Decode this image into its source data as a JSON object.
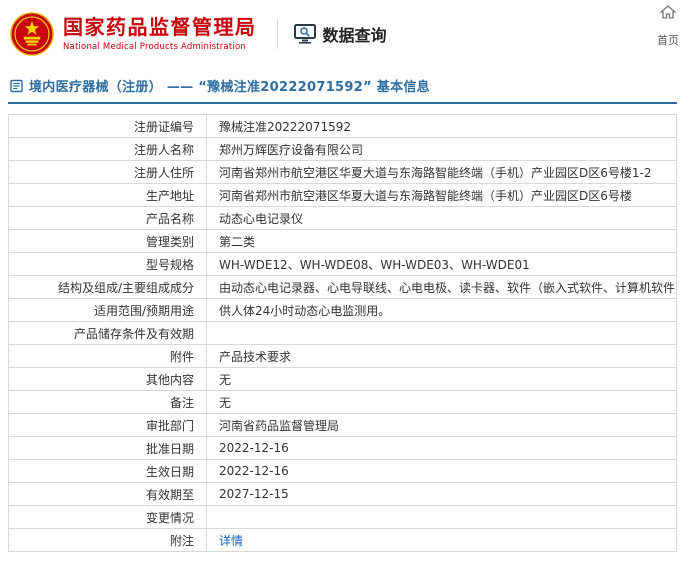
{
  "header": {
    "agency_cn": "国家药品监督管理局",
    "agency_en": "National Medical Products Administration",
    "section_title": "数据查询",
    "home_label": "首页"
  },
  "page": {
    "title": "境内医疗器械（注册） —— “豫械注准20222071592” 基本信息"
  },
  "table": {
    "rows": [
      {
        "label": "注册证编号",
        "value": "豫械注准20222071592"
      },
      {
        "label": "注册人名称",
        "value": "郑州万辉医疗设备有限公司"
      },
      {
        "label": "注册人住所",
        "value": "河南省郑州市航空港区华夏大道与东海路智能终端（手机）产业园区D区6号楼1-2"
      },
      {
        "label": "生产地址",
        "value": "河南省郑州市航空港区华夏大道与东海路智能终端（手机）产业园区D区6号楼"
      },
      {
        "label": "产品名称",
        "value": "动态心电记录仪"
      },
      {
        "label": "管理类别",
        "value": "第二类"
      },
      {
        "label": "型号规格",
        "value": "WH-WDE12、WH-WDE08、WH-WDE03、WH-WDE01"
      },
      {
        "label": "结构及组成/主要组成成分",
        "value": "由动态心电记录器、心电导联线、心电电极、读卡器、软件（嵌入式软件、计算机软件）组成。"
      },
      {
        "label": "适用范围/预期用途",
        "value": "供人体24小时动态心电监测用。"
      },
      {
        "label": "产品储存条件及有效期",
        "value": ""
      },
      {
        "label": "附件",
        "value": "产品技术要求"
      },
      {
        "label": "其他内容",
        "value": "无"
      },
      {
        "label": "备注",
        "value": "无"
      },
      {
        "label": "审批部门",
        "value": "河南省药品监督管理局"
      },
      {
        "label": "批准日期",
        "value": "2022-12-16"
      },
      {
        "label": "生效日期",
        "value": "2022-12-16"
      },
      {
        "label": "有效期至",
        "value": "2027-12-15"
      },
      {
        "label": "变更情况",
        "value": ""
      },
      {
        "label": "附注",
        "value": "详情",
        "link": true
      }
    ]
  },
  "colors": {
    "brand_red": "#c7000b",
    "title_blue": "#2d6da3",
    "link_blue": "#1a66b3",
    "border_gray": "#d9d9d9"
  }
}
